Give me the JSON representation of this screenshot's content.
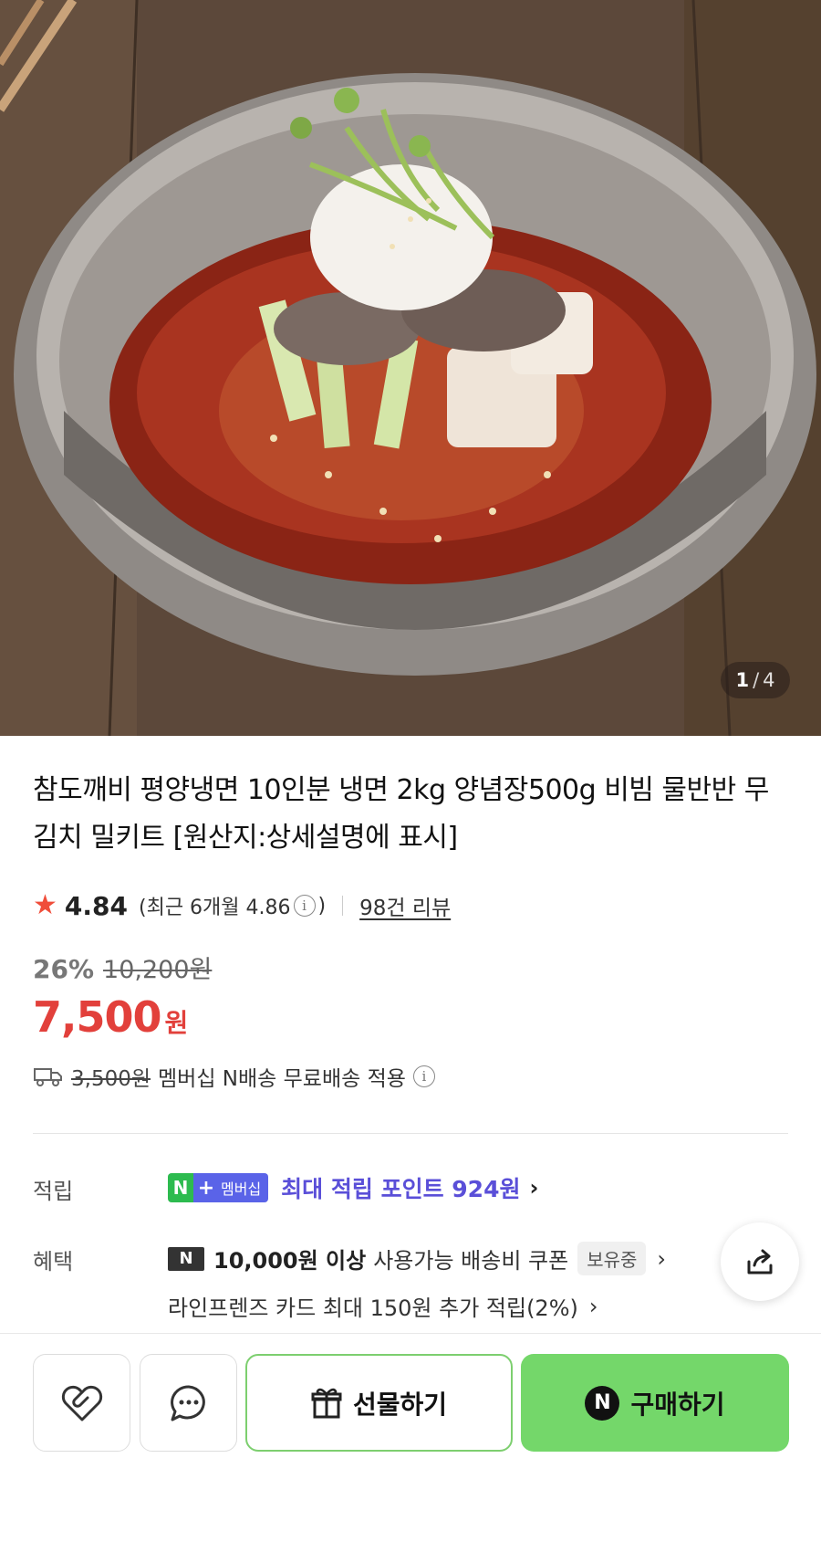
{
  "gallery": {
    "current": "1",
    "separator": "/",
    "total": "4"
  },
  "product": {
    "title": "참도깨비 평양냉면 10인분 냉면 2kg 양념장500g 비빔 물반반 무김치 밀키트 [원산지:상세설명에 표시]",
    "rating": "4.84",
    "recent_prefix": "(최근 6개월 4.86",
    "recent_suffix": ")",
    "reviews": "98건 리뷰",
    "discount_rate": "26%",
    "original_price": "10,200원",
    "sale_price": "7,500",
    "currency": "원"
  },
  "shipping": {
    "original_fee": "3,500원",
    "text": "멤버십 N배송 무료배송 적용"
  },
  "points": {
    "label": "적립",
    "badge_n": "N",
    "badge_plus": "+",
    "badge_member": "멤버십",
    "text": "최대 적립 포인트 924원"
  },
  "benefit": {
    "label": "혜택",
    "mark": "N",
    "strong": "10,000원 이상",
    "text": "사용가능 배송비 쿠폰",
    "owned_badge": "보유중",
    "card_text": "라인프렌즈 카드 최대 150원 추가 적립(2%)"
  },
  "actions": {
    "gift_label": "선물하기",
    "buy_label": "구매하기",
    "buy_n": "N"
  },
  "colors": {
    "price": "#e2403b",
    "points": "#5a4fd8",
    "buy_button": "#74d76a",
    "star": "#f04d3a"
  }
}
